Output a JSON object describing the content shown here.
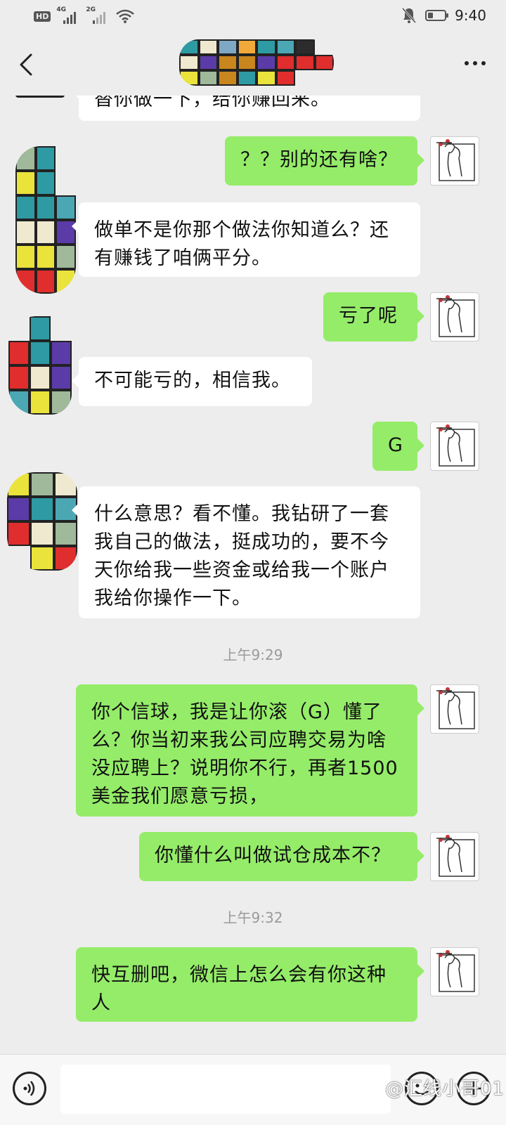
{
  "status_bar": {
    "hd": "HD",
    "net1": "4G",
    "net2": "2G",
    "time": "9:40"
  },
  "colors": {
    "background": "#EDEDED",
    "incoming_bubble": "#FFFFFF",
    "outgoing_bubble": "#95EC69",
    "timestamp_text": "#9A9A9A"
  },
  "messages": [
    {
      "side": "in",
      "text": "替你做一下，给你赚回来。"
    },
    {
      "side": "out",
      "text": "？？别的还有啥？"
    },
    {
      "side": "in",
      "text": "做单不是你那个做法你知道么？还有赚钱了咱俩平分。"
    },
    {
      "side": "out",
      "text": "亏了呢"
    },
    {
      "side": "in",
      "text": "不可能亏的，相信我。"
    },
    {
      "side": "out",
      "text": "G"
    },
    {
      "side": "in",
      "text": "什么意思？看不懂。我钻研了一套我自己的做法，挺成功的，要不今天你给我一些资金或给我一个账户我给你操作一下。"
    },
    {
      "side": "time",
      "text": "上午9:29"
    },
    {
      "side": "out",
      "text": "你个信球，我是让你滚（G）懂了么？你当初来我公司应聘交易为啥没应聘上？说明你不行，再者1500美金我们愿意亏损，"
    },
    {
      "side": "out",
      "text": "你懂什么叫做试仓成本不？"
    },
    {
      "side": "time",
      "text": "上午9:32"
    },
    {
      "side": "out",
      "text": "快互删吧，微信上怎么会有你这种人"
    }
  ],
  "input": {
    "value": "",
    "watermark": "@汇线小哥01"
  },
  "icons": {
    "back": "back-arrow-icon",
    "more": "more-dots-icon",
    "voice": "voice-icon",
    "emoji": "emoji-icon",
    "plus": "plus-icon"
  }
}
